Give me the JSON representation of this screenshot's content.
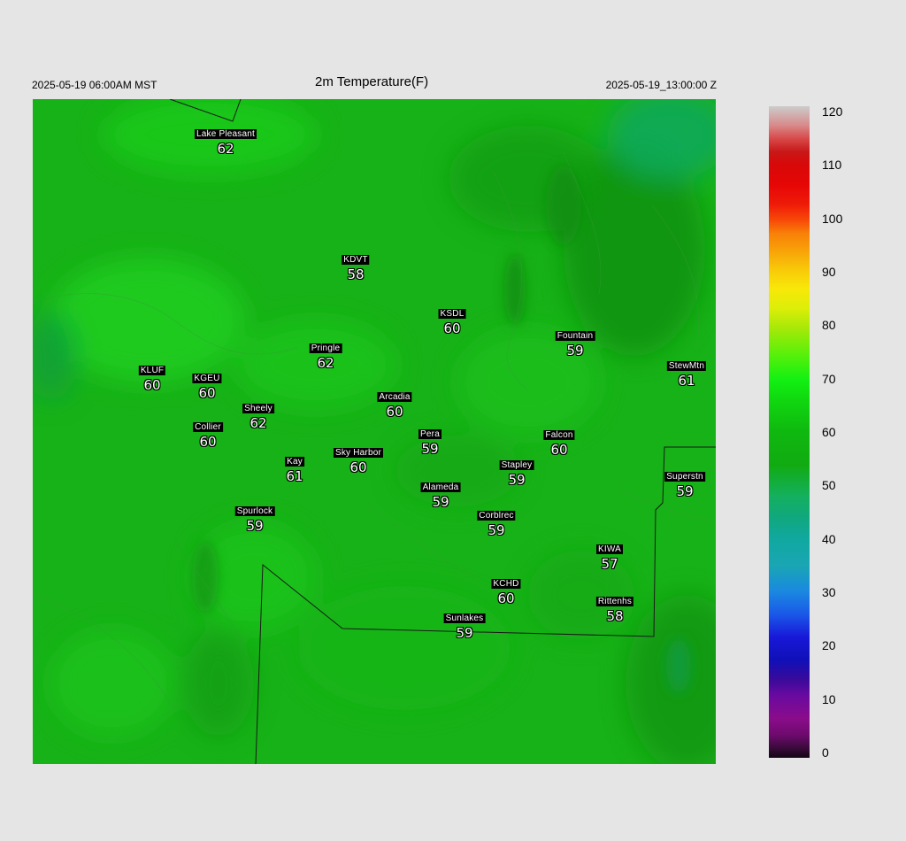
{
  "header": {
    "local_time": "2025-05-19 06:00AM MST",
    "title": "2m Temperature(F)",
    "utc_time": "2025-05-19_13:00:00 Z"
  },
  "stations": [
    {
      "name": "Lake Pleasant",
      "value": "62"
    },
    {
      "name": "KDVT",
      "value": "58"
    },
    {
      "name": "KSDL",
      "value": "60"
    },
    {
      "name": "Fountain",
      "value": "59"
    },
    {
      "name": "Pringle",
      "value": "62"
    },
    {
      "name": "KLUF",
      "value": "60"
    },
    {
      "name": "KGEU",
      "value": "60"
    },
    {
      "name": "StewMtn",
      "value": "61"
    },
    {
      "name": "Arcadia",
      "value": "60"
    },
    {
      "name": "Sheely",
      "value": "62"
    },
    {
      "name": "Collier",
      "value": "60"
    },
    {
      "name": "Pera",
      "value": "59"
    },
    {
      "name": "Falcon",
      "value": "60"
    },
    {
      "name": "Kay",
      "value": "61"
    },
    {
      "name": "Sky Harbor",
      "value": "60"
    },
    {
      "name": "Stapley",
      "value": "59"
    },
    {
      "name": "Superstn",
      "value": "59"
    },
    {
      "name": "Alameda",
      "value": "59"
    },
    {
      "name": "Spurlock",
      "value": "59"
    },
    {
      "name": "Corblrec",
      "value": "59"
    },
    {
      "name": "KIWA",
      "value": "57"
    },
    {
      "name": "KCHD",
      "value": "60"
    },
    {
      "name": "Rittenhs",
      "value": "58"
    },
    {
      "name": "Sunlakes",
      "value": "59"
    }
  ],
  "colorbar": {
    "ticks": [
      "120",
      "110",
      "100",
      "90",
      "80",
      "70",
      "60",
      "50",
      "40",
      "30",
      "20",
      "10",
      "0"
    ]
  }
}
